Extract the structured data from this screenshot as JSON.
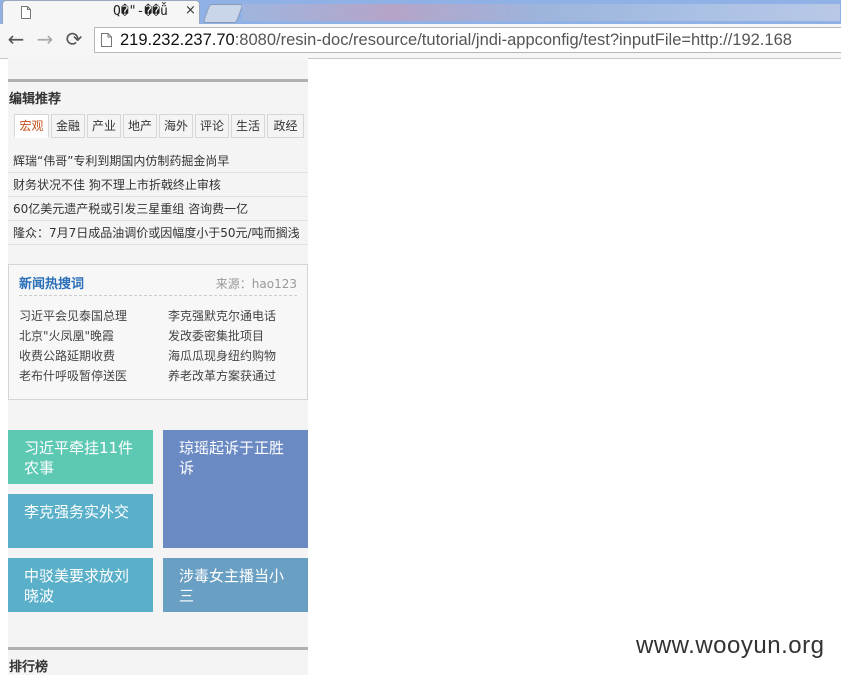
{
  "browser": {
    "tab_title": "Q�\"-��ǚ",
    "tab_close": "×",
    "url_host": "219.232.237.70",
    "url_rest": ":8080/resin-doc/resource/tutorial/jndi-appconfig/test?inputFile=http://192.168"
  },
  "editor_picks": {
    "title": "编辑推荐",
    "tabs": [
      {
        "label": "宏观"
      },
      {
        "label": "金融"
      },
      {
        "label": "产业"
      },
      {
        "label": "地产"
      },
      {
        "label": "海外"
      },
      {
        "label": "评论"
      },
      {
        "label": "生活"
      },
      {
        "label": "政经"
      }
    ],
    "active_tab": "宏观",
    "headlines": [
      "辉瑞“伟哥”专利到期国内仿制药掘金尚早",
      "财务状况不佳 狗不理上市折戟终止审核",
      "60亿美元遗产税或引发三星重组 咨询费一亿",
      "隆众：7月7日成品油调价或因幅度小于50元/吨而搁浅"
    ]
  },
  "hot_search": {
    "title": "新闻热搜词",
    "source": "来源：hao123",
    "left": [
      "习近平会见泰国总理",
      "北京\"火凤凰\"晚霞",
      "收费公路延期收费",
      "老布什呼吸暂停送医"
    ],
    "right": [
      "李克强默克尔通电话",
      "发改委密集批项目",
      "海瓜瓜现身纽约购物",
      "养老改革方案获通过"
    ]
  },
  "tiles": [
    {
      "text": "习近平牵挂11件农事",
      "color": "#5ec9b3"
    },
    {
      "text": "琼瑶起诉于正胜诉",
      "color": "#6b8ac4"
    },
    {
      "text": "李克强务实外交",
      "color": "#5aafc9"
    },
    {
      "text": "中驳美要求放刘晓波",
      "color": "#5aafc9"
    },
    {
      "text": "涉毒女主播当小三",
      "color": "#6a9fc4"
    }
  ],
  "ranking": {
    "title": "排行榜"
  },
  "watermark": "www.wooyun.org",
  "icons": {
    "back": "←",
    "forward": "→",
    "reload": "⟳"
  }
}
